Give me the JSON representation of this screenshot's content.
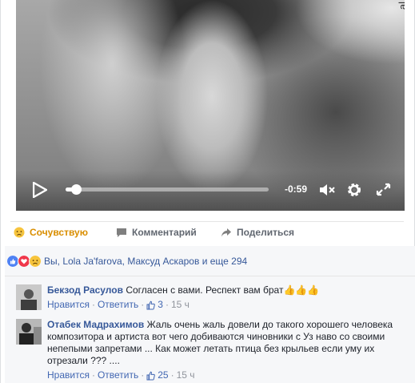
{
  "video": {
    "corner_text": "al",
    "time_remaining": "-0:59",
    "progress_fraction": 0.05,
    "icons": [
      "play-icon",
      "volume-muted-icon",
      "gear-icon",
      "fullscreen-icon"
    ]
  },
  "actions": {
    "like_label": "Сочувствую",
    "comment_label": "Комментарий",
    "share_label": "Поделиться"
  },
  "reactions": {
    "icons": [
      "like-reaction",
      "love-reaction",
      "sad-reaction"
    ],
    "you": "Вы,",
    "names": "Lola Ja'farova, Максуд Аскаров",
    "and_more": "и еще 294"
  },
  "comments": [
    {
      "author": "Бекзод Расулов",
      "text": "Согласен с вами. Респект вам брат👍👍👍",
      "like_label": "Нравится",
      "reply_label": "Ответить",
      "likes": "3",
      "time": "15 ч"
    },
    {
      "author": "Отабек Мадрахимов",
      "text": "Жаль очень жаль довели до такого хорошего человека композитора и артиста вот чего добиваются чиновники с Уз наво со своими непепыми запретами ... Как может летать птица без крыльев если уму их отрезали ??? ....",
      "like_label": "Нравится",
      "reply_label": "Ответить",
      "likes": "25",
      "time": "15 ч"
    }
  ],
  "colors": {
    "link": "#365899",
    "action_liked": "#d98e00",
    "muted": "#90949c"
  }
}
